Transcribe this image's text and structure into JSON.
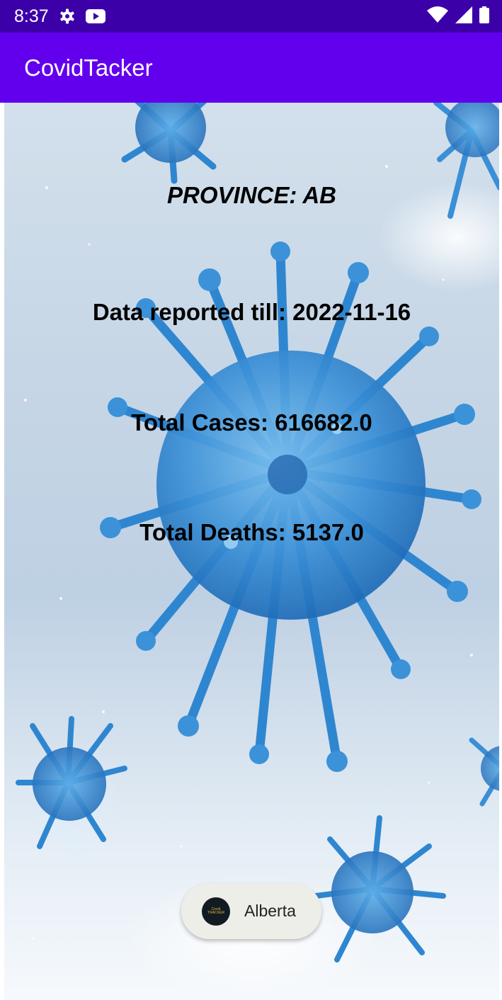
{
  "status_bar": {
    "time": "8:37",
    "icons": [
      "settings-icon",
      "youtube-icon",
      "wifi-icon",
      "signal-icon",
      "battery-icon"
    ]
  },
  "app_bar": {
    "title": "CovidTacker"
  },
  "stats": {
    "province": "PROVINCE: AB",
    "date_reported": "Data reported till: 2022-11-16",
    "total_cases": "Total Cases: 616682.0",
    "total_deaths": "Total Deaths: 5137.0"
  },
  "chip": {
    "label": "Alberta",
    "logo_line1": "Covid",
    "logo_line2": "TRACKER"
  },
  "colors": {
    "status_bar": "#3c00a8",
    "app_bar": "#6200ee",
    "virus": "#3a8fd6",
    "chip": "#eeeee9"
  }
}
